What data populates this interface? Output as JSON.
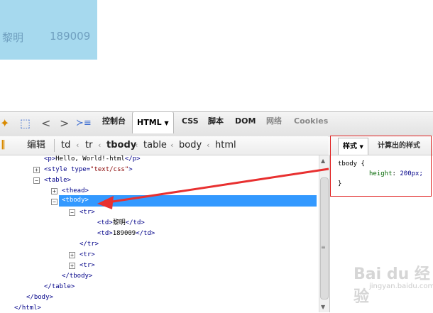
{
  "preview": {
    "name": "黎明",
    "value": "189009"
  },
  "toolbar": {
    "tabs": [
      "控制台",
      "HTML",
      "CSS",
      "脚本",
      "DOM",
      "网络",
      "Cookies"
    ],
    "edit_label": "编辑"
  },
  "breadcrumb": [
    "td",
    "tr",
    "tbody",
    "table",
    "body",
    "html"
  ],
  "tree": {
    "p_text": "Hello, World!-html",
    "style_type": "text/css",
    "td1": "黎明",
    "td2": "189009"
  },
  "side": {
    "tab_style": "样式",
    "tab_computed": "计算出的样式",
    "selector": "tbody {",
    "prop": "height",
    "value": "200px;",
    "close": "}"
  },
  "watermark": {
    "main": "Bai du 经验",
    "sub": "jingyan.baidu.com"
  },
  "colors": {
    "selection": "#3399ff",
    "highlight_box": "#e02020",
    "arrow": "#e83030"
  }
}
